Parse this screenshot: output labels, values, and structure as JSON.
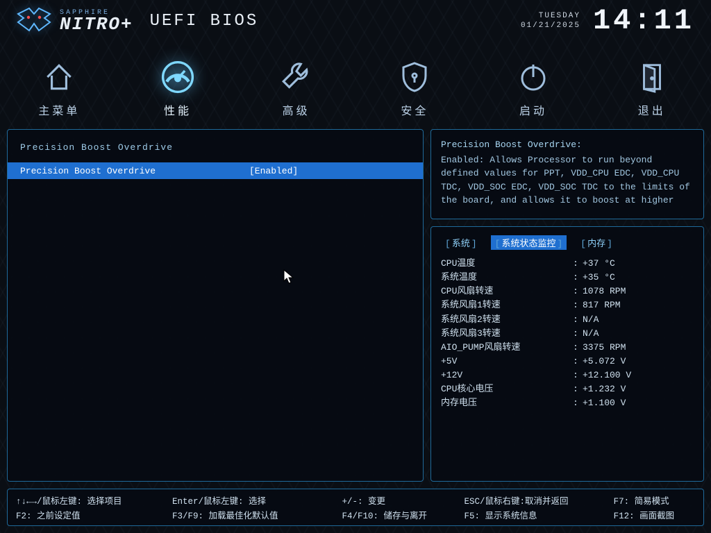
{
  "header": {
    "brand_small": "SAPPHIRE",
    "brand_big": "NITRO+",
    "title": "UEFI BIOS",
    "dow": "TUESDAY",
    "date": "01/21/2025",
    "time": "14:11"
  },
  "nav": {
    "items": [
      {
        "id": "main",
        "label": "主菜单",
        "icon": "home"
      },
      {
        "id": "perf",
        "label": "性能",
        "icon": "gauge",
        "active": true
      },
      {
        "id": "adv",
        "label": "高级",
        "icon": "wrench"
      },
      {
        "id": "sec",
        "label": "安全",
        "icon": "shield"
      },
      {
        "id": "boot",
        "label": "启动",
        "icon": "power"
      },
      {
        "id": "exit",
        "label": "退出",
        "icon": "door"
      }
    ]
  },
  "main": {
    "section_title": "Precision Boost Overdrive",
    "rows": [
      {
        "name": "Precision Boost Overdrive",
        "value": "[Enabled]",
        "selected": true
      }
    ]
  },
  "help": {
    "title": "Precision Boost Overdrive:",
    "body": "  Enabled: Allows Processor to run beyond defined values for PPT, VDD_CPU EDC, VDD_CPU TDC, VDD_SOC EDC, VDD_SOC TDC to the limits of the board, and allows it to boost at higher"
  },
  "monitor": {
    "tabs": [
      {
        "id": "sys",
        "label": "系统"
      },
      {
        "id": "hwmon",
        "label": "系统状态监控",
        "active": true
      },
      {
        "id": "mem",
        "label": "内存"
      }
    ],
    "rows": [
      {
        "k": "CPU温度",
        "v": "+37 °C"
      },
      {
        "k": "系统温度",
        "v": "+35 °C"
      },
      {
        "k": "CPU风扇转速",
        "v": "1078 RPM"
      },
      {
        "k": "系统风扇1转速",
        "v": "817 RPM"
      },
      {
        "k": "系统风扇2转速",
        "v": "N/A"
      },
      {
        "k": "系统风扇3转速",
        "v": "N/A"
      },
      {
        "k": "AIO_PUMP风扇转速",
        "v": "3375 RPM"
      },
      {
        "k": "+5V",
        "v": "+5.072 V"
      },
      {
        "k": "+12V",
        "v": "+12.100 V"
      },
      {
        "k": "CPU核心电压",
        "v": "+1.232 V"
      },
      {
        "k": "内存电压",
        "v": "+1.100 V"
      }
    ]
  },
  "footer": {
    "cols": [
      [
        "↑↓←→/鼠标左键: 选择项目",
        "F2: 之前设定值"
      ],
      [
        "Enter/鼠标左键: 选择",
        "F3/F9: 加载最佳化默认值"
      ],
      [
        "+/-: 变更",
        "F4/F10: 储存与离开"
      ],
      [
        "ESC/鼠标右键:取消并返回",
        "F5: 显示系统信息"
      ],
      [
        "F7: 简易模式",
        "F12: 画面截图"
      ]
    ]
  }
}
